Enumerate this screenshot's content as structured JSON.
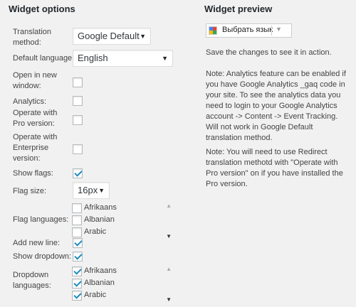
{
  "options": {
    "heading": "Widget options",
    "translation_method": {
      "label": "Translation method:",
      "value": "Google Default"
    },
    "default_language": {
      "label": "Default language:",
      "value": "English"
    },
    "open_new_window": {
      "label": "Open in new window:",
      "checked": false
    },
    "analytics": {
      "label": "Analytics:",
      "checked": false
    },
    "operate_pro": {
      "label": "Operate with Pro version:",
      "checked": false
    },
    "operate_enterprise": {
      "label": "Operate with Enterprise version:",
      "checked": false
    },
    "show_flags": {
      "label": "Show flags:",
      "checked": true
    },
    "flag_size": {
      "label": "Flag size:",
      "value": "16px"
    },
    "flag_languages": {
      "label": "Flag languages:",
      "items": [
        {
          "name": "Afrikaans",
          "checked": false
        },
        {
          "name": "Albanian",
          "checked": false
        },
        {
          "name": "Arabic",
          "checked": false
        }
      ]
    },
    "add_new_line": {
      "label": "Add new line:",
      "checked": true
    },
    "show_dropdown": {
      "label": "Show dropdown:",
      "checked": true
    },
    "dropdown_languages": {
      "label": "Dropdown languages:",
      "items": [
        {
          "name": "Afrikaans",
          "checked": true
        },
        {
          "name": "Albanian",
          "checked": true
        },
        {
          "name": "Arabic",
          "checked": true
        }
      ]
    }
  },
  "preview": {
    "heading": "Widget preview",
    "translate_widget": {
      "text": "Выбрать язык"
    },
    "save_note": "Save the changes to see it in action.",
    "note1": "Note: Analytics feature can be enabled if you have Google Analytics _gaq code in your site. To see the analytics data you need to login to your Google Analytics account -> Content -> Event Tracking. Will not work in Google Default translation method.",
    "note2": "Note: You will need to use Redirect translation methotd with \"Operate with Pro version\" on if you have installed the Pro version."
  }
}
